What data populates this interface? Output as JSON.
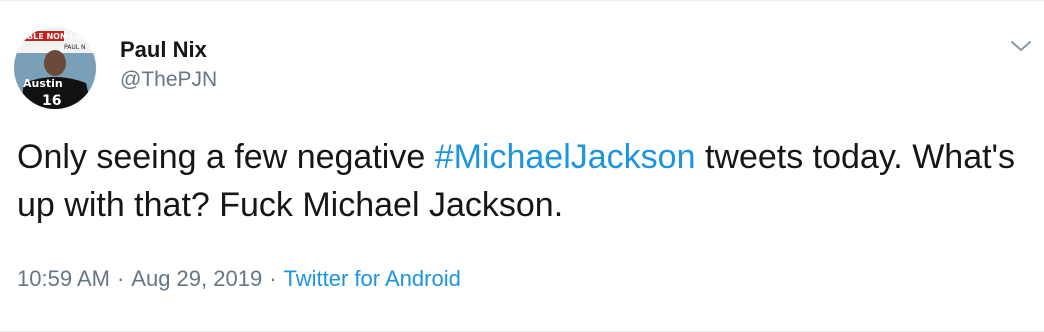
{
  "tweet": {
    "author": {
      "display_name": "Paul Nix",
      "handle": "@ThePJN",
      "avatar_text_top": "TABLE NON-LA",
      "avatar_text_small": "PAUL N",
      "avatar_shirt_text": "Austin",
      "avatar_shirt_number": "16"
    },
    "text_before": "Only seeing a few negative ",
    "hashtag": "#MichaelJackson",
    "text_after": " tweets today. What's up with that? Fuck Michael Jackson.",
    "time": "10:59 AM",
    "separator": "·",
    "date": "Aug 29, 2019",
    "source": "Twitter for Android",
    "menu_icon": "chevron-down-icon"
  },
  "colors": {
    "text": "#14171a",
    "secondary": "#657786",
    "link": "#1b95e0",
    "border": "#e6ecf0"
  }
}
